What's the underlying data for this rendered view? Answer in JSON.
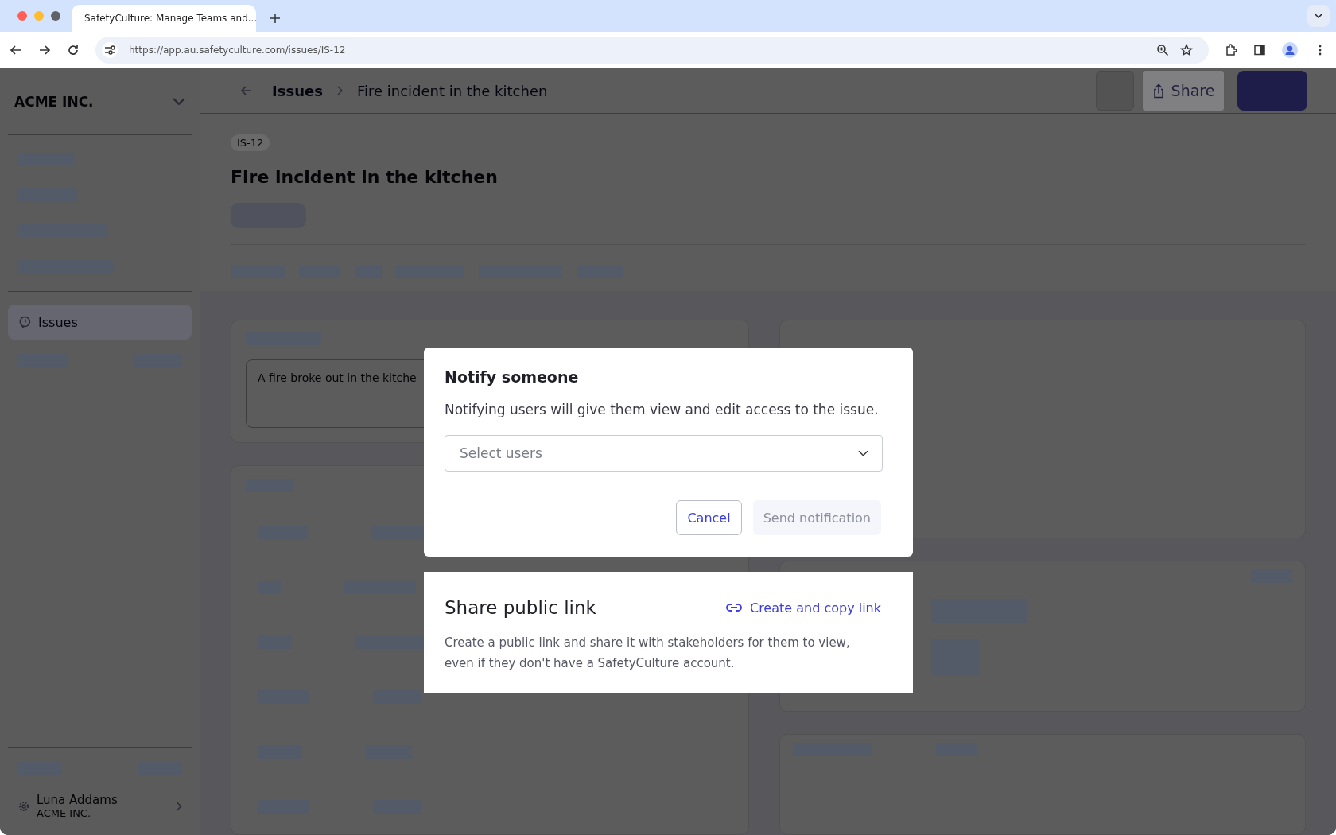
{
  "browser": {
    "tab_title": "SafetyCulture: Manage Teams and...",
    "url": "https://app.au.safetyculture.com/issues/IS-12"
  },
  "sidebar": {
    "org_name": "ACME INC.",
    "items": [
      {
        "label": "Issues",
        "selected": true
      }
    ],
    "user": {
      "name": "Luna Addams",
      "org": "ACME INC."
    }
  },
  "header": {
    "breadcrumb": [
      "Issues",
      "Fire incident in the kitchen"
    ],
    "share_button": "Share"
  },
  "issue": {
    "id": "IS-12",
    "title": "Fire incident in the kitchen",
    "description": "A fire broke out in the kitche"
  },
  "notify_dialog": {
    "title": "Notify someone",
    "text": "Notifying users will give them view and edit access to the issue.",
    "select": {
      "placeholder": "Select users"
    },
    "cancel": "Cancel",
    "send": {
      "label": "Send notification",
      "disabled": true
    }
  },
  "share_dialog": {
    "title": "Share public link",
    "link": "Create and copy link",
    "text": "Create a public link and share it with stakeholders for them to view, even if they don't have a SafetyCulture account."
  }
}
